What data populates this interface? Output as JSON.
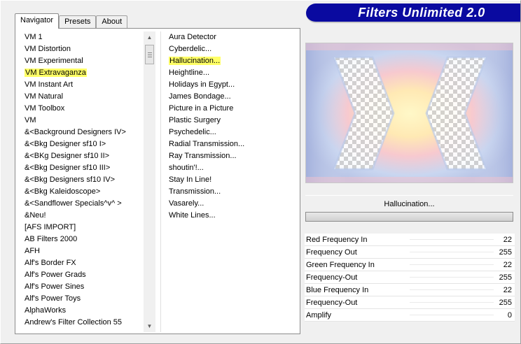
{
  "banner": {
    "title": "Filters Unlimited 2.0"
  },
  "tabs": [
    {
      "label": "Navigator",
      "active": true
    },
    {
      "label": "Presets",
      "active": false
    },
    {
      "label": "About",
      "active": false
    }
  ],
  "categories": [
    "VM 1",
    "VM Distortion",
    "VM Experimental",
    "VM Extravaganza",
    "VM Instant Art",
    "VM Natural",
    "VM Toolbox",
    "VM",
    "&<Background Designers IV>",
    "&<Bkg Designer sf10 I>",
    "&<BKg Designer sf10 II>",
    "&<Bkg Designer sf10 III>",
    "&<Bkg Designers sf10 IV>",
    "&<Bkg Kaleidoscope>",
    "&<Sandflower Specials^v^ >",
    "&Neu!",
    "[AFS IMPORT]",
    "AB Filters 2000",
    "AFH",
    "Alf's Border FX",
    "Alf's Power Grads",
    "Alf's Power Sines",
    "Alf's Power Toys",
    "AlphaWorks",
    "Andrew's Filter Collection 55"
  ],
  "selected_category_index": 3,
  "filters": [
    " Aura Detector",
    "Cyberdelic...",
    "Hallucination...",
    "Heightline...",
    "Holidays in Egypt...",
    "James Bondage...",
    "Picture in a Picture",
    "Plastic Surgery",
    "Psychedelic...",
    "Radial Transmission...",
    "Ray Transmission...",
    "shoutin'!...",
    "Stay In Line!",
    "Transmission...",
    "Vasarely...",
    "White Lines..."
  ],
  "selected_filter_index": 2,
  "selected_filter_name": "Hallucination...",
  "progress_fraction": 0,
  "params": [
    {
      "label": "Red Frequency In",
      "value": "22"
    },
    {
      "label": "Frequency Out",
      "value": "255"
    },
    {
      "label": "Green Frequency In",
      "value": "22"
    },
    {
      "label": "Frequency-Out",
      "value": "255"
    },
    {
      "label": "Blue Frequency In",
      "value": "22"
    },
    {
      "label": "Frequency-Out",
      "value": "255"
    },
    {
      "label": "Amplify",
      "value": "0"
    }
  ],
  "colors": {
    "banner": "#0a0aa0",
    "highlight": "#ffff66"
  },
  "icons": {
    "scroll_up": "scroll-up-arrow-icon",
    "scroll_down": "scroll-down-arrow-icon"
  }
}
